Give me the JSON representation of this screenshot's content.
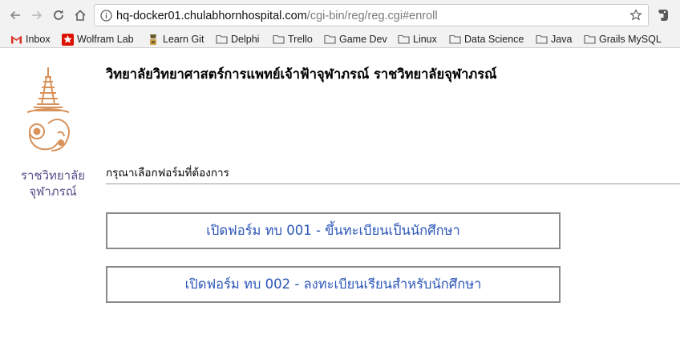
{
  "browser": {
    "url_host": "hq-docker01.chulabhornhospital.com",
    "url_path": "/cgi-bin/reg/reg.cgi#enroll"
  },
  "bookmarks": [
    {
      "label": "Inbox",
      "icon": "gmail-icon"
    },
    {
      "label": "Wolfram Lab",
      "icon": "wolfram-icon"
    },
    {
      "label": "Learn Git",
      "icon": "learn-git-icon"
    },
    {
      "label": "Delphi",
      "icon": "folder-icon"
    },
    {
      "label": "Trello",
      "icon": "folder-icon"
    },
    {
      "label": "Game Dev",
      "icon": "folder-icon"
    },
    {
      "label": "Linux",
      "icon": "folder-icon"
    },
    {
      "label": "Data Science",
      "icon": "folder-icon"
    },
    {
      "label": "Java",
      "icon": "folder-icon"
    },
    {
      "label": "Grails MySQL",
      "icon": "folder-icon"
    }
  ],
  "logo": {
    "line1": "ราชวิทยาลัย",
    "line2": "จุฬาภรณ์",
    "color": "#d9925a"
  },
  "page": {
    "title": "วิทยาลัยวิทยาศาสตร์การแพทย์เจ้าฟ้าจุฬาภรณ์ ราชวิทยาลัยจุฬาภรณ์",
    "prompt": "กรุณาเลือกฟอร์มที่ต้องการ",
    "buttons": [
      "เปิดฟอร์ม ทบ 001 - ขึ้นทะเบียนเป็นนักศึกษา",
      "เปิดฟอร์ม ทบ 002 - ลงทะเบียนเรียนสำหรับนักศึกษา"
    ],
    "link_color": "#2b56b8"
  }
}
